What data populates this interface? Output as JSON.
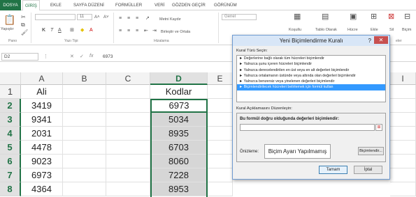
{
  "ribbon_tabs": [
    "DOSYA",
    "GİRİŞ",
    "EKLE",
    "SAYFA DÜZENİ",
    "FORMÜLLER",
    "VERİ",
    "GÖZDEN GEÇİR",
    "GÖRÜNÜM"
  ],
  "ribbon": {
    "paste_label": "Yapıştır",
    "font_name": "",
    "font_size": "11",
    "wrap_text": "Metni Kaydır",
    "merge_center": "Birleştir ve Ortala",
    "number_format": "Genel",
    "conditional_format": "Koşullu",
    "format_as_table": "Tablo Olarak",
    "cell_styles": "Hücre",
    "insert": "Ekle",
    "delete": "Sil",
    "format": "Biçim",
    "groups": [
      "Pano",
      "Yazı Tipi",
      "Hizalama",
      "eler"
    ]
  },
  "formula_bar": {
    "name_box": "D2",
    "formula": "6973"
  },
  "grid": {
    "columns": [
      "A",
      "B",
      "C",
      "D",
      "E",
      "I"
    ],
    "rows": [
      "1",
      "2",
      "3",
      "4",
      "5",
      "6",
      "7",
      "8"
    ],
    "col_a": [
      "Ali",
      "3419",
      "9341",
      "2031",
      "4478",
      "9023",
      "6973",
      "4364"
    ],
    "col_d": [
      "Kodlar",
      "6973",
      "5034",
      "8935",
      "6703",
      "8060",
      "7228",
      "8953"
    ]
  },
  "dialog": {
    "title": "Yeni Biçimlendirme Kuralı",
    "help": "?",
    "close": "✕",
    "rule_type_label": "Kural Türü Seçin:",
    "rules": [
      "► Değerlerine bağlı olarak tüm hücreleri biçimlendir",
      "► Yalnızca şunu içeren hücreleri biçimlendir",
      "► Yalnızca derecelendirilen en üst veya en alt değerleri biçimlendir",
      "► Yalnızca ortalamanın üstünde veya altında olan değerleri biçimlendir",
      "► Yalnızca benzersiz veya yinelenen değerleri biçimlendir",
      "► Biçimlendirilecek hücreleri belirlemek için formül kullan"
    ],
    "selected_rule_index": 5,
    "desc_label": "Kural Açıklamasını Düzenleyin:",
    "formula_label": "Bu formül doğru olduğunda değerleri biçimlendir:",
    "formula_value": "",
    "preview_label": "Önizleme:",
    "preview_text": "Biçim Ayarı Yapılmamış",
    "format_button": "Biçimlendir...",
    "ok_button": "Tamam",
    "cancel_button": "İptal"
  }
}
